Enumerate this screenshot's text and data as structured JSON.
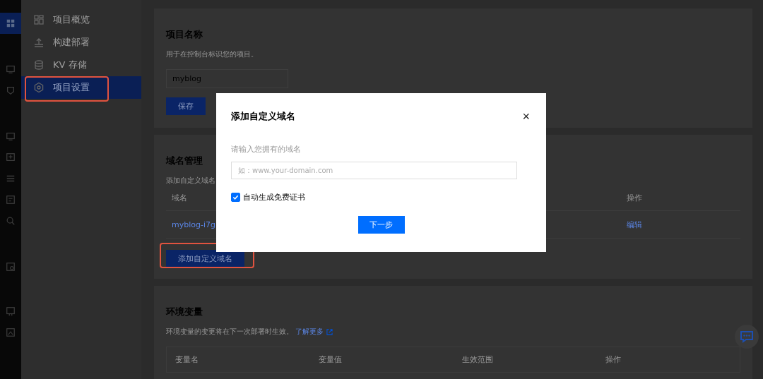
{
  "rail": {
    "items": [
      {
        "selected": true
      },
      {
        "selected": false
      },
      {
        "selected": false
      },
      {
        "selected": false
      },
      {
        "selected": false
      },
      {
        "selected": false
      },
      {
        "selected": false
      },
      {
        "selected": false
      },
      {
        "selected": false
      },
      {
        "selected": false
      },
      {
        "selected": false
      }
    ]
  },
  "nav": {
    "items": [
      {
        "label": "项目概览",
        "selected": false
      },
      {
        "label": "构建部署",
        "selected": false
      },
      {
        "label": "KV 存储",
        "selected": false
      },
      {
        "label": "项目设置",
        "selected": true,
        "highlighted": true
      }
    ]
  },
  "project_name": {
    "title": "项目名称",
    "description": "用于在控制台标识您的项目。",
    "value": "myblog",
    "button": "保存"
  },
  "domains": {
    "title": "域名管理",
    "description": "添加自定义域名",
    "columns": [
      "域名",
      "操作"
    ],
    "rows": [
      {
        "domain": "myblog-i7g",
        "action": "编辑"
      }
    ],
    "add_button": "添加自定义域名",
    "add_button_highlighted": true
  },
  "env": {
    "title": "环境变量",
    "description": "环境变量的变更将在下一次部署时生效。",
    "link": "了解更多",
    "columns": [
      "变量名",
      "变量值",
      "生效范围",
      "操作"
    ]
  },
  "dialog": {
    "title": "添加自定义域名",
    "close": "×",
    "label": "请输入您拥有的域名",
    "placeholder": "如：www.your-domain.com",
    "checkbox": {
      "label": "自动生成免费证书",
      "checked": true
    },
    "button": "下一步"
  }
}
